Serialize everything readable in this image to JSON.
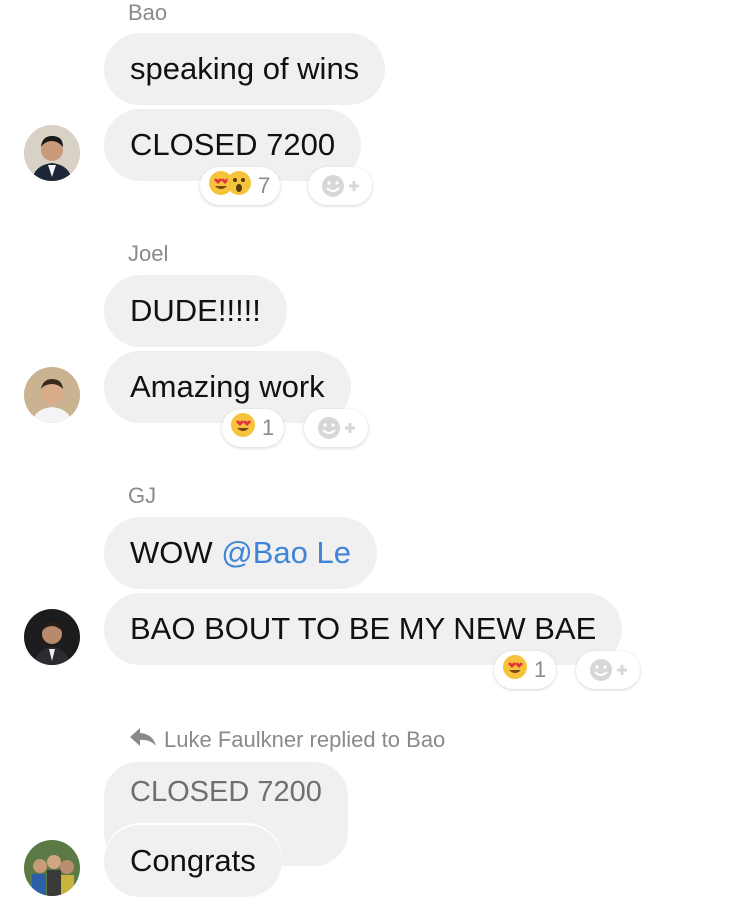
{
  "groups": [
    {
      "sender": "Bao",
      "messages": [
        "speaking of wins",
        "CLOSED 7200"
      ],
      "reaction": {
        "emojis": [
          "heart-eyes",
          "wow"
        ],
        "count": "7"
      }
    },
    {
      "sender": "Joel",
      "messages": [
        "DUDE!!!!!",
        "Amazing work"
      ],
      "reaction": {
        "emojis": [
          "heart-eyes"
        ],
        "count": "1"
      }
    },
    {
      "sender": "GJ",
      "messages": [
        {
          "text": "WOW ",
          "mention": "@Bao Le"
        },
        "BAO BOUT TO BE MY NEW BAE"
      ],
      "reaction": {
        "emojis": [
          "heart-eyes"
        ],
        "count": "1"
      }
    }
  ],
  "reply": {
    "notice": "Luke Faulkner replied to Bao",
    "quoted": "CLOSED 7200",
    "message": "Congrats"
  },
  "colors": {
    "bubble": "#f0f0f0",
    "mention": "#3f84d8",
    "meta_text": "#8a8a8e"
  },
  "icons": [
    "heart-eyes-emoji",
    "wow-emoji",
    "add-reaction-icon",
    "reply-arrow-icon"
  ]
}
